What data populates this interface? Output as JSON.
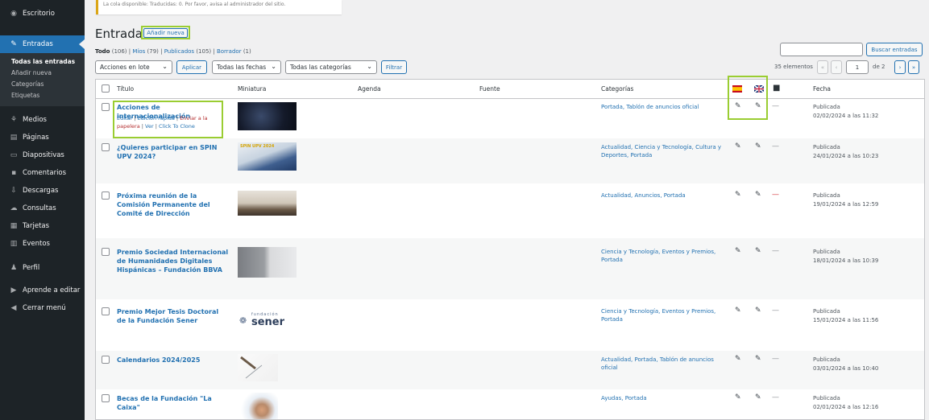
{
  "notice": {
    "text": "La cola disponible: Traducidas: 0. Por favor, avisa al administrador del sitio."
  },
  "sidebar": {
    "top": {
      "label": "Escritorio",
      "icon": "dashboard-icon"
    },
    "posts": {
      "label": "Entradas",
      "icon": "pin-icon"
    },
    "sub": [
      "Todas las entradas",
      "Añadir nueva",
      "Categorías",
      "Etiquetas"
    ],
    "items": [
      {
        "label": "Medios",
        "icon": "media-icon"
      },
      {
        "label": "Páginas",
        "icon": "pages-icon"
      },
      {
        "label": "Diapositivas",
        "icon": "slides-icon"
      },
      {
        "label": "Comentarios",
        "icon": "comments-icon"
      },
      {
        "label": "Descargas",
        "icon": "downloads-icon"
      },
      {
        "label": "Consultas",
        "icon": "cloud-icon"
      },
      {
        "label": "Tarjetas",
        "icon": "cards-icon"
      },
      {
        "label": "Eventos",
        "icon": "calendar-icon"
      },
      {
        "label": "Perfil",
        "icon": "user-icon"
      },
      {
        "label": "Aprende a editar",
        "icon": "video-icon"
      },
      {
        "label": "Cerrar menú",
        "icon": "collapse-icon"
      }
    ]
  },
  "header": {
    "title": "Entradas",
    "add_new": "Añadir nueva"
  },
  "filters": {
    "all": "Todo",
    "all_count": "(106)",
    "mine": "Míos",
    "mine_count": "(79)",
    "published": "Publicados",
    "published_count": "(105)",
    "draft": "Borrador",
    "draft_count": "(1)"
  },
  "search": {
    "button": "Buscar entradas"
  },
  "tablenav": {
    "bulk": "Acciones en lote",
    "apply": "Aplicar",
    "dates": "Todas las fechas",
    "categories": "Todas las categorías",
    "filter": "Filtrar",
    "count": "35 elementos",
    "page": "1",
    "of": "de 2"
  },
  "columns": {
    "title": "Título",
    "thumb": "Miniatura",
    "agenda": "Agenda",
    "source": "Fuente",
    "categories": "Categorías",
    "date": "Fecha"
  },
  "row_actions": {
    "edit": "Editar",
    "quick": "Edición rápida",
    "trash": "Enviar a la papelera",
    "view": "Ver",
    "clone": "Click To Clone"
  },
  "thumb_texts": {
    "spin": "SPIN UPV 2024",
    "sener_small": "fundación",
    "sener": "sener"
  },
  "posts": [
    {
      "title": "Acciones de internacionalización",
      "categories": "Portada, Tablón de anuncios oficial",
      "status": "Publicada",
      "date": "02/02/2024 a las 11:32",
      "thumb": "dark"
    },
    {
      "title": "¿Quieres participar en SPIN UPV 2024?",
      "categories": "Actualidad, Ciencia y Tecnología, Cultura y Deportes, Portada",
      "status": "Publicada",
      "date": "24/01/2024 a las 10:23",
      "thumb": "spin"
    },
    {
      "title": "Próxima reunión de la Comisión Permanente del Comité de Dirección",
      "categories": "Actualidad, Anuncios, Portada",
      "status": "Publicada",
      "date": "19/01/2024 a las 12:59",
      "thumb": "meeting"
    },
    {
      "title": "Premio Sociedad Internacional de Humanidades Digitales Hispánicas – Fundación BBVA",
      "categories": "Ciencia y Tecnología, Eventos y Premios, Portada",
      "status": "Publicada",
      "date": "18/01/2024 a las 10:39",
      "thumb": "grey"
    },
    {
      "title": "Premio Mejor Tesis Doctoral de la Fundación Sener",
      "categories": "Ciencia y Tecnología, Eventos y Premios, Portada",
      "status": "Publicada",
      "date": "15/01/2024 a las 11:56",
      "thumb": "sener"
    },
    {
      "title": "Calendarios 2024/2025",
      "categories": "Actualidad, Portada, Tablón de anuncios oficial",
      "status": "Publicada",
      "date": "03/01/2024 a las 10:40",
      "thumb": "calendar"
    },
    {
      "title": "Becas de la Fundación \"La Caixa\"",
      "categories": "Ayudas, Portada",
      "status": "Publicada",
      "date": "02/01/2024 a las 12:16",
      "thumb": "caixa"
    }
  ]
}
